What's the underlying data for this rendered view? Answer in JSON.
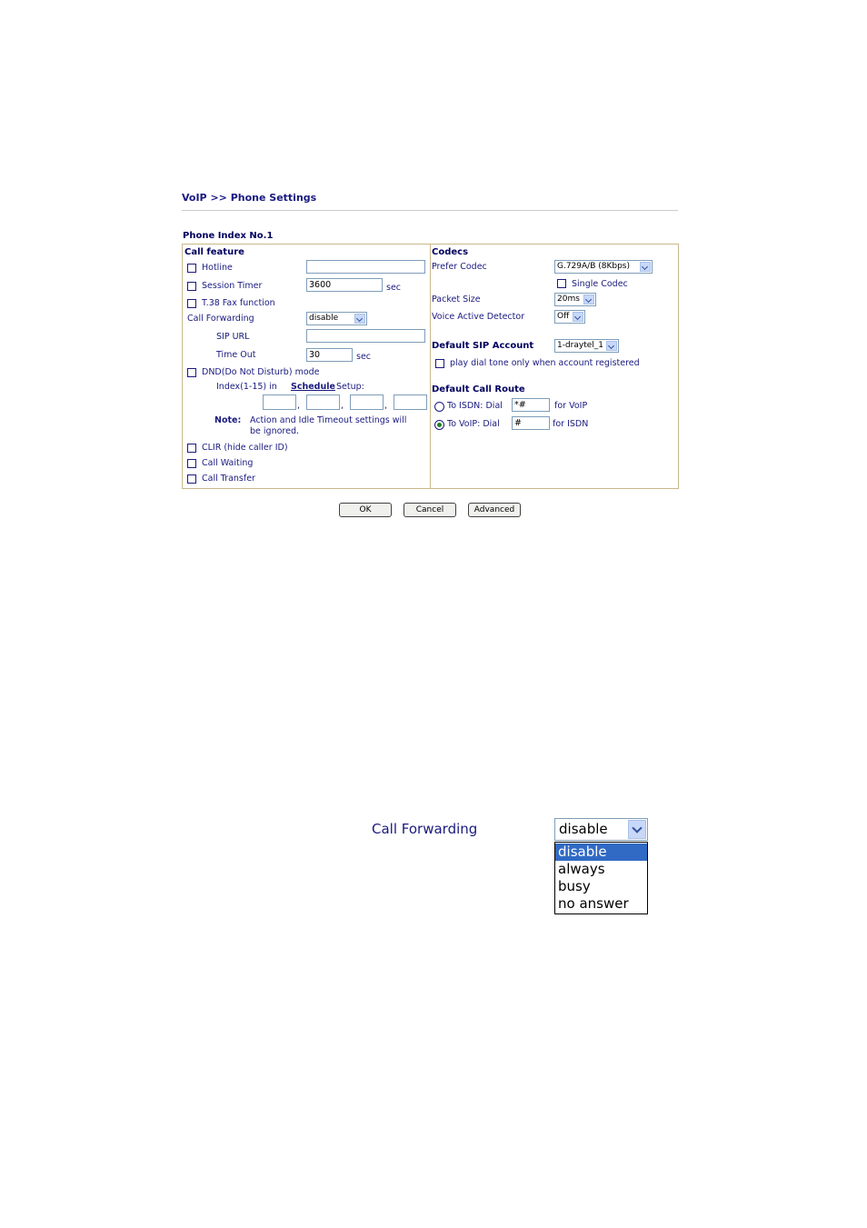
{
  "header": {
    "title": "VoIP >> Phone Settings"
  },
  "phone_index": "Phone Index No.1",
  "call_feature": {
    "heading": "Call feature",
    "hotline": {
      "label": "Hotline",
      "checked": false,
      "value": ""
    },
    "session_timer": {
      "label": "Session Timer",
      "checked": false,
      "value": "3600",
      "unit": "sec"
    },
    "t38": {
      "label": "T.38 Fax function",
      "checked": false
    },
    "call_forwarding": {
      "label": "Call Forwarding",
      "selected": "disable"
    },
    "sip_url": {
      "label": "SIP URL",
      "value": ""
    },
    "time_out": {
      "label": "Time Out",
      "value": "30",
      "unit": "sec"
    },
    "dnd": {
      "label": "DND(Do Not Disturb) mode",
      "checked": false
    },
    "schedule": {
      "prefix": "Index(1-15) in",
      "link": "Schedule",
      "suffix": "Setup:",
      "values": [
        "",
        "",
        "",
        ""
      ],
      "sep": ","
    },
    "note": {
      "label": "Note:",
      "line1": "Action and Idle Timeout settings will",
      "line2": "be ignored."
    },
    "clir": {
      "label": "CLIR (hide caller ID)",
      "checked": false
    },
    "call_waiting": {
      "label": "Call Waiting",
      "checked": false
    },
    "call_transfer": {
      "label": "Call Transfer",
      "checked": false
    }
  },
  "codecs": {
    "heading": "Codecs",
    "prefer_codec": {
      "label": "Prefer Codec",
      "selected": "G.729A/B (8Kbps)"
    },
    "single_codec": {
      "label": "Single Codec",
      "checked": false
    },
    "packet_size": {
      "label": "Packet Size",
      "selected": "20ms"
    },
    "vad": {
      "label": "Voice Active Detector",
      "selected": "Off"
    }
  },
  "default_sip": {
    "heading": "Default SIP Account",
    "selected": "1-draytel_1",
    "dial_tone": {
      "label": "play dial tone only when account registered",
      "checked": false
    }
  },
  "default_route": {
    "heading": "Default Call Route",
    "to_isdn": {
      "label": "To ISDN: Dial",
      "value": "*#",
      "suffix": "for VoIP",
      "selected": false
    },
    "to_voip": {
      "label": "To VoIP: Dial",
      "value": "#",
      "suffix": "for ISDN",
      "selected": true
    }
  },
  "buttons": {
    "ok": "OK",
    "cancel": "Cancel",
    "advanced": "Advanced"
  },
  "zoom": {
    "label": "Call Forwarding",
    "selected": "disable",
    "options": [
      "disable",
      "always",
      "busy",
      "no answer"
    ]
  }
}
